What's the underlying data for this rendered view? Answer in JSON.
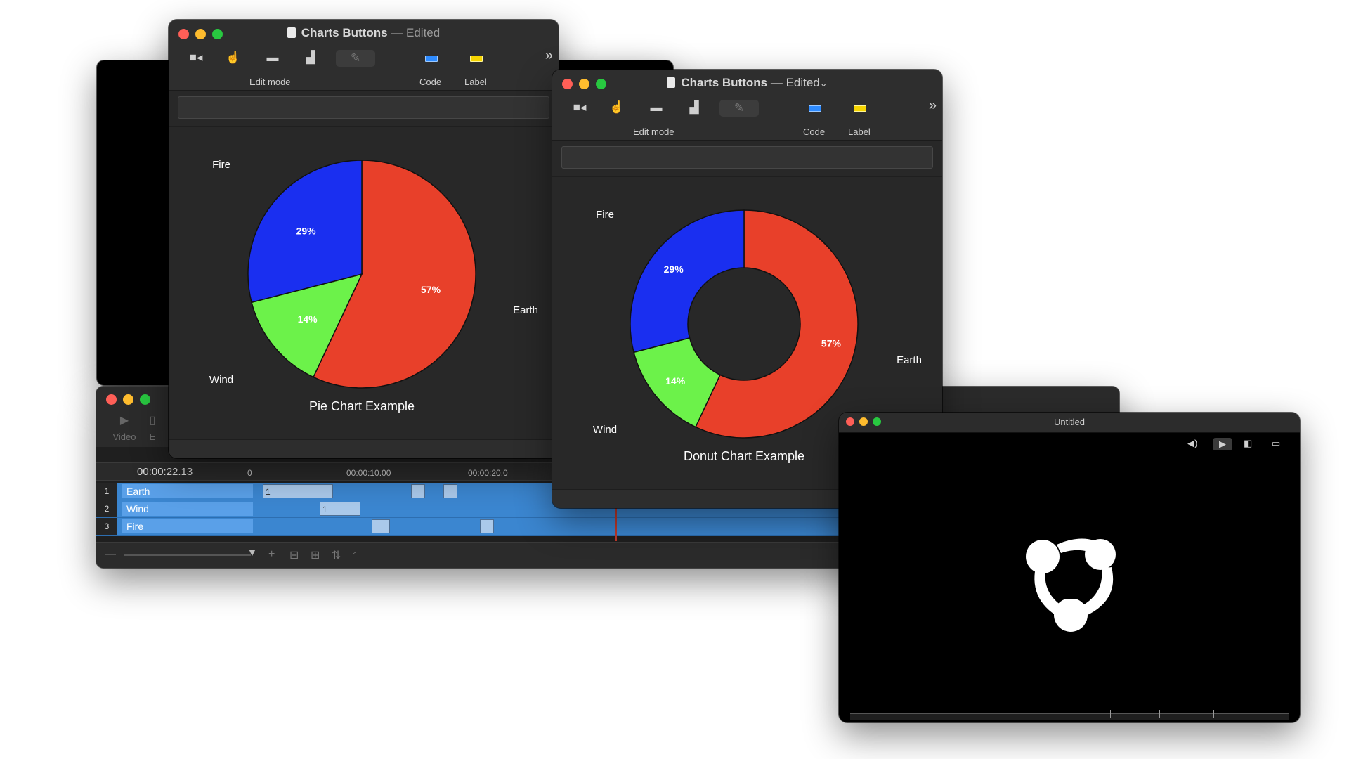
{
  "colors": {
    "earth": "#e8402a",
    "fire": "#1a2ff0",
    "wind": "#6cf24a",
    "chart_bg": "#282828",
    "timeline_track": "#3b86d0"
  },
  "timeline_window": {
    "tools": [
      {
        "label": "Video",
        "icon": "video-icon"
      },
      {
        "label": "E",
        "icon": "edit-icon"
      }
    ],
    "current_time": "00:00:22.13",
    "ruler_marks": [
      "0",
      "00:00:10.00",
      "00:00:20.0"
    ],
    "tracks": [
      {
        "number": "1",
        "name": "Earth",
        "clip_labels": [
          "1",
          "",
          ""
        ]
      },
      {
        "number": "2",
        "name": "Wind",
        "clip_labels": [
          "1"
        ]
      },
      {
        "number": "3",
        "name": "Fire",
        "clip_labels": [
          "",
          ""
        ]
      }
    ],
    "footer_icons": [
      "minus-icon",
      "zoom-slider",
      "plus-icon",
      "add-track-icon",
      "split-icon",
      "sort-icon",
      "rss-icon"
    ]
  },
  "pie_window": {
    "title": "Charts Buttons",
    "separator": "—",
    "edited": "Edited",
    "toolbar": {
      "icons": [
        "camera-icon",
        "hand-pointer-icon",
        "rectangle-icon",
        "bar-chart-icon",
        "pencil-icon"
      ],
      "edit_mode_label": "Edit mode",
      "code_label": "Code",
      "label_label": "Label",
      "overflow": "»"
    }
  },
  "donut_window": {
    "title": "Charts Buttons",
    "separator": "—",
    "edited": "Edited",
    "dropdown": "⌄",
    "toolbar": {
      "icons": [
        "camera-icon",
        "hand-pointer-icon",
        "rectangle-icon",
        "bar-chart-icon",
        "pencil-icon"
      ],
      "edit_mode_label": "Edit mode",
      "code_label": "Code",
      "label_label": "Label",
      "overflow": "»"
    }
  },
  "untitled_window": {
    "title": "Untitled",
    "controls": [
      "volume-icon",
      "video-toggle-icon",
      "mirror-icon",
      "display-icon"
    ]
  },
  "chart_data": [
    {
      "type": "pie",
      "title": "Pie Chart Example",
      "categories": [
        "Earth",
        "Wind",
        "Fire"
      ],
      "values": [
        57,
        14,
        29
      ],
      "value_labels": [
        "57%",
        "14%",
        "29%"
      ],
      "colors": [
        "#e8402a",
        "#6cf24a",
        "#1a2ff0"
      ]
    },
    {
      "type": "pie",
      "variant": "donut",
      "title": "Donut Chart Example",
      "categories": [
        "Earth",
        "Wind",
        "Fire"
      ],
      "values": [
        57,
        14,
        29
      ],
      "value_labels": [
        "57%",
        "14%",
        "29%"
      ],
      "colors": [
        "#e8402a",
        "#6cf24a",
        "#1a2ff0"
      ]
    }
  ]
}
